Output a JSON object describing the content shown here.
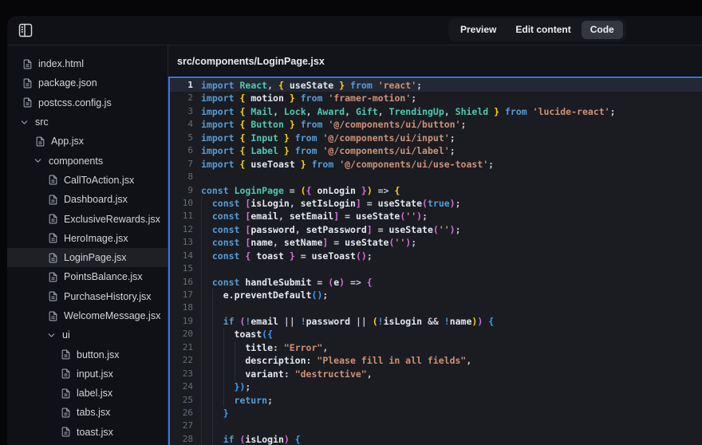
{
  "topbar": {
    "toggle_icon": "panel-left-icon",
    "tabs": [
      {
        "label": "Preview",
        "active": false
      },
      {
        "label": "Edit content",
        "active": false
      },
      {
        "label": "Code",
        "active": true
      }
    ]
  },
  "sidebar": {
    "files": [
      {
        "label": "index.html",
        "kind": "file",
        "depth": 0
      },
      {
        "label": "package.json",
        "kind": "file",
        "depth": 0
      },
      {
        "label": "postcss.config.js",
        "kind": "file",
        "depth": 0
      },
      {
        "label": "src",
        "kind": "folder",
        "depth": 0,
        "expanded": true
      },
      {
        "label": "App.jsx",
        "kind": "file",
        "depth": 1
      },
      {
        "label": "components",
        "kind": "folder",
        "depth": 1,
        "expanded": true
      },
      {
        "label": "CallToAction.jsx",
        "kind": "file",
        "depth": 2
      },
      {
        "label": "Dashboard.jsx",
        "kind": "file",
        "depth": 2
      },
      {
        "label": "ExclusiveRewards.jsx",
        "kind": "file",
        "depth": 2
      },
      {
        "label": "HeroImage.jsx",
        "kind": "file",
        "depth": 2
      },
      {
        "label": "LoginPage.jsx",
        "kind": "file",
        "depth": 2,
        "selected": true
      },
      {
        "label": "PointsBalance.jsx",
        "kind": "file",
        "depth": 2
      },
      {
        "label": "PurchaseHistory.jsx",
        "kind": "file",
        "depth": 2
      },
      {
        "label": "WelcomeMessage.jsx",
        "kind": "file",
        "depth": 2
      },
      {
        "label": "ui",
        "kind": "folder",
        "depth": 2,
        "expanded": true
      },
      {
        "label": "button.jsx",
        "kind": "file",
        "depth": 3
      },
      {
        "label": "input.jsx",
        "kind": "file",
        "depth": 3
      },
      {
        "label": "label.jsx",
        "kind": "file",
        "depth": 3
      },
      {
        "label": "tabs.jsx",
        "kind": "file",
        "depth": 3
      },
      {
        "label": "toast.jsx",
        "kind": "file",
        "depth": 3
      }
    ]
  },
  "editor": {
    "path": "src/components/LoginPage.jsx",
    "active_line": 1,
    "token_colors": {
      "keyword": "#569cd6",
      "operator": "#569cd6",
      "class": "#4ec9b0",
      "identifier": "#e4e8ef",
      "plain": "#c6cad2",
      "string": "#ce9178",
      "bracket1": "#ffd700",
      "bracket2": "#d670d6",
      "bracket3": "#3a9eff",
      "focus_border": "#3674f0",
      "line_highlight": "#242834"
    },
    "lines": [
      {
        "n": 1,
        "ind": 0,
        "t": [
          [
            "kw",
            "import"
          ],
          [
            "pl",
            " "
          ],
          [
            "cls",
            "React"
          ],
          [
            "pl",
            ", "
          ],
          [
            "y",
            "{"
          ],
          [
            "pl",
            " "
          ],
          [
            "id",
            "useState"
          ],
          [
            "pl",
            " "
          ],
          [
            "y",
            "}"
          ],
          [
            "pl",
            " "
          ],
          [
            "kw",
            "from"
          ],
          [
            "pl",
            " "
          ],
          [
            "str",
            "'react'"
          ],
          [
            "pl",
            ";"
          ]
        ]
      },
      {
        "n": 2,
        "ind": 0,
        "t": [
          [
            "kw",
            "import"
          ],
          [
            "pl",
            " "
          ],
          [
            "y",
            "{"
          ],
          [
            "pl",
            " "
          ],
          [
            "id",
            "motion"
          ],
          [
            "pl",
            " "
          ],
          [
            "y",
            "}"
          ],
          [
            "pl",
            " "
          ],
          [
            "kw",
            "from"
          ],
          [
            "pl",
            " "
          ],
          [
            "str",
            "'framer-motion'"
          ],
          [
            "pl",
            ";"
          ]
        ]
      },
      {
        "n": 3,
        "ind": 0,
        "t": [
          [
            "kw",
            "import"
          ],
          [
            "pl",
            " "
          ],
          [
            "y",
            "{"
          ],
          [
            "pl",
            " "
          ],
          [
            "cls",
            "Mail"
          ],
          [
            "pl",
            ", "
          ],
          [
            "cls",
            "Lock"
          ],
          [
            "pl",
            ", "
          ],
          [
            "cls",
            "Award"
          ],
          [
            "pl",
            ", "
          ],
          [
            "cls",
            "Gift"
          ],
          [
            "pl",
            ", "
          ],
          [
            "cls",
            "TrendingUp"
          ],
          [
            "pl",
            ", "
          ],
          [
            "cls",
            "Shield"
          ],
          [
            "pl",
            " "
          ],
          [
            "y",
            "}"
          ],
          [
            "pl",
            " "
          ],
          [
            "kw",
            "from"
          ],
          [
            "pl",
            " "
          ],
          [
            "str",
            "'lucide-react'"
          ],
          [
            "pl",
            ";"
          ]
        ]
      },
      {
        "n": 4,
        "ind": 0,
        "t": [
          [
            "kw",
            "import"
          ],
          [
            "pl",
            " "
          ],
          [
            "y",
            "{"
          ],
          [
            "pl",
            " "
          ],
          [
            "cls",
            "Button"
          ],
          [
            "pl",
            " "
          ],
          [
            "y",
            "}"
          ],
          [
            "pl",
            " "
          ],
          [
            "kw",
            "from"
          ],
          [
            "pl",
            " "
          ],
          [
            "str",
            "'@/components/ui/button'"
          ],
          [
            "pl",
            ";"
          ]
        ]
      },
      {
        "n": 5,
        "ind": 0,
        "t": [
          [
            "kw",
            "import"
          ],
          [
            "pl",
            " "
          ],
          [
            "y",
            "{"
          ],
          [
            "pl",
            " "
          ],
          [
            "cls",
            "Input"
          ],
          [
            "pl",
            " "
          ],
          [
            "y",
            "}"
          ],
          [
            "pl",
            " "
          ],
          [
            "kw",
            "from"
          ],
          [
            "pl",
            " "
          ],
          [
            "str",
            "'@/components/ui/input'"
          ],
          [
            "pl",
            ";"
          ]
        ]
      },
      {
        "n": 6,
        "ind": 0,
        "t": [
          [
            "kw",
            "import"
          ],
          [
            "pl",
            " "
          ],
          [
            "y",
            "{"
          ],
          [
            "pl",
            " "
          ],
          [
            "cls",
            "Label"
          ],
          [
            "pl",
            " "
          ],
          [
            "y",
            "}"
          ],
          [
            "pl",
            " "
          ],
          [
            "kw",
            "from"
          ],
          [
            "pl",
            " "
          ],
          [
            "str",
            "'@/components/ui/label'"
          ],
          [
            "pl",
            ";"
          ]
        ]
      },
      {
        "n": 7,
        "ind": 0,
        "t": [
          [
            "kw",
            "import"
          ],
          [
            "pl",
            " "
          ],
          [
            "y",
            "{"
          ],
          [
            "pl",
            " "
          ],
          [
            "id",
            "useToast"
          ],
          [
            "pl",
            " "
          ],
          [
            "y",
            "}"
          ],
          [
            "pl",
            " "
          ],
          [
            "kw",
            "from"
          ],
          [
            "pl",
            " "
          ],
          [
            "str",
            "'@/components/ui/use-toast'"
          ],
          [
            "pl",
            ";"
          ]
        ]
      },
      {
        "n": 8,
        "ind": 0,
        "t": []
      },
      {
        "n": 9,
        "ind": 0,
        "t": [
          [
            "kw",
            "const"
          ],
          [
            "pl",
            " "
          ],
          [
            "cls",
            "LoginPage"
          ],
          [
            "pl",
            " = "
          ],
          [
            "y",
            "("
          ],
          [
            "p",
            "{"
          ],
          [
            "pl",
            " "
          ],
          [
            "id",
            "onLogin"
          ],
          [
            "pl",
            " "
          ],
          [
            "p",
            "}"
          ],
          [
            "y",
            ")"
          ],
          [
            "pl",
            " => "
          ],
          [
            "y",
            "{"
          ]
        ]
      },
      {
        "n": 10,
        "ind": 2,
        "t": [
          [
            "kw",
            "const"
          ],
          [
            "pl",
            " "
          ],
          [
            "p",
            "["
          ],
          [
            "id",
            "isLogin"
          ],
          [
            "pl",
            ", "
          ],
          [
            "id",
            "setIsLogin"
          ],
          [
            "p",
            "]"
          ],
          [
            "pl",
            " = "
          ],
          [
            "id",
            "useState"
          ],
          [
            "p",
            "("
          ],
          [
            "kw",
            "true"
          ],
          [
            "p",
            ")"
          ],
          [
            "pl",
            ";"
          ]
        ]
      },
      {
        "n": 11,
        "ind": 2,
        "t": [
          [
            "kw",
            "const"
          ],
          [
            "pl",
            " "
          ],
          [
            "p",
            "["
          ],
          [
            "id",
            "email"
          ],
          [
            "pl",
            ", "
          ],
          [
            "id",
            "setEmail"
          ],
          [
            "p",
            "]"
          ],
          [
            "pl",
            " = "
          ],
          [
            "id",
            "useState"
          ],
          [
            "p",
            "("
          ],
          [
            "str",
            "''"
          ],
          [
            "p",
            ")"
          ],
          [
            "pl",
            ";"
          ]
        ]
      },
      {
        "n": 12,
        "ind": 2,
        "t": [
          [
            "kw",
            "const"
          ],
          [
            "pl",
            " "
          ],
          [
            "p",
            "["
          ],
          [
            "id",
            "password"
          ],
          [
            "pl",
            ", "
          ],
          [
            "id",
            "setPassword"
          ],
          [
            "p",
            "]"
          ],
          [
            "pl",
            " = "
          ],
          [
            "id",
            "useState"
          ],
          [
            "p",
            "("
          ],
          [
            "str",
            "''"
          ],
          [
            "p",
            ")"
          ],
          [
            "pl",
            ";"
          ]
        ]
      },
      {
        "n": 13,
        "ind": 2,
        "t": [
          [
            "kw",
            "const"
          ],
          [
            "pl",
            " "
          ],
          [
            "p",
            "["
          ],
          [
            "id",
            "name"
          ],
          [
            "pl",
            ", "
          ],
          [
            "id",
            "setName"
          ],
          [
            "p",
            "]"
          ],
          [
            "pl",
            " = "
          ],
          [
            "id",
            "useState"
          ],
          [
            "p",
            "("
          ],
          [
            "str",
            "''"
          ],
          [
            "p",
            ")"
          ],
          [
            "pl",
            ";"
          ]
        ]
      },
      {
        "n": 14,
        "ind": 2,
        "t": [
          [
            "kw",
            "const"
          ],
          [
            "pl",
            " "
          ],
          [
            "p",
            "{"
          ],
          [
            "pl",
            " "
          ],
          [
            "id",
            "toast"
          ],
          [
            "pl",
            " "
          ],
          [
            "p",
            "}"
          ],
          [
            "pl",
            " = "
          ],
          [
            "id",
            "useToast"
          ],
          [
            "p",
            "("
          ],
          [
            "p",
            ")"
          ],
          [
            "pl",
            ";"
          ]
        ]
      },
      {
        "n": 15,
        "ind": 2,
        "t": []
      },
      {
        "n": 16,
        "ind": 2,
        "t": [
          [
            "kw",
            "const"
          ],
          [
            "pl",
            " "
          ],
          [
            "id",
            "handleSubmit"
          ],
          [
            "pl",
            " = "
          ],
          [
            "p",
            "("
          ],
          [
            "id",
            "e"
          ],
          [
            "p",
            ")"
          ],
          [
            "pl",
            " => "
          ],
          [
            "p",
            "{"
          ]
        ]
      },
      {
        "n": 17,
        "ind": 4,
        "t": [
          [
            "id",
            "e"
          ],
          [
            "pl",
            "."
          ],
          [
            "id",
            "preventDefault"
          ],
          [
            "b",
            "("
          ],
          [
            "b",
            ")"
          ],
          [
            "pl",
            ";"
          ]
        ]
      },
      {
        "n": 18,
        "ind": 4,
        "t": []
      },
      {
        "n": 19,
        "ind": 4,
        "t": [
          [
            "kw",
            "if"
          ],
          [
            "pl",
            " "
          ],
          [
            "p",
            "("
          ],
          [
            "op",
            "!"
          ],
          [
            "id",
            "email"
          ],
          [
            "pl",
            " || "
          ],
          [
            "op",
            "!"
          ],
          [
            "id",
            "password"
          ],
          [
            "pl",
            " || "
          ],
          [
            "y",
            "("
          ],
          [
            "op",
            "!"
          ],
          [
            "id",
            "isLogin"
          ],
          [
            "pl",
            " && "
          ],
          [
            "op",
            "!"
          ],
          [
            "id",
            "name"
          ],
          [
            "y",
            ")"
          ],
          [
            "p",
            ")"
          ],
          [
            "pl",
            " "
          ],
          [
            "b",
            "{"
          ]
        ]
      },
      {
        "n": 20,
        "ind": 6,
        "t": [
          [
            "id",
            "toast"
          ],
          [
            "b",
            "("
          ],
          [
            "b",
            "{"
          ]
        ]
      },
      {
        "n": 21,
        "ind": 8,
        "t": [
          [
            "id",
            "title"
          ],
          [
            "pl",
            ": "
          ],
          [
            "str",
            "\"Error\""
          ],
          [
            "pl",
            ","
          ]
        ]
      },
      {
        "n": 22,
        "ind": 8,
        "t": [
          [
            "id",
            "description"
          ],
          [
            "pl",
            ": "
          ],
          [
            "str",
            "\"Please fill in all fields\""
          ],
          [
            "pl",
            ","
          ]
        ]
      },
      {
        "n": 23,
        "ind": 8,
        "t": [
          [
            "id",
            "variant"
          ],
          [
            "pl",
            ": "
          ],
          [
            "str",
            "\"destructive\""
          ],
          [
            "pl",
            ","
          ]
        ]
      },
      {
        "n": 24,
        "ind": 6,
        "t": [
          [
            "b",
            "}"
          ],
          [
            "b",
            ")"
          ],
          [
            "pl",
            ";"
          ]
        ]
      },
      {
        "n": 25,
        "ind": 6,
        "t": [
          [
            "kw",
            "return"
          ],
          [
            "pl",
            ";"
          ]
        ]
      },
      {
        "n": 26,
        "ind": 4,
        "t": [
          [
            "b",
            "}"
          ]
        ]
      },
      {
        "n": 27,
        "ind": 4,
        "t": []
      },
      {
        "n": 28,
        "ind": 4,
        "t": [
          [
            "kw",
            "if"
          ],
          [
            "pl",
            " "
          ],
          [
            "p",
            "("
          ],
          [
            "id",
            "isLogin"
          ],
          [
            "p",
            ")"
          ],
          [
            "pl",
            " "
          ],
          [
            "b",
            "{"
          ]
        ]
      }
    ]
  }
}
